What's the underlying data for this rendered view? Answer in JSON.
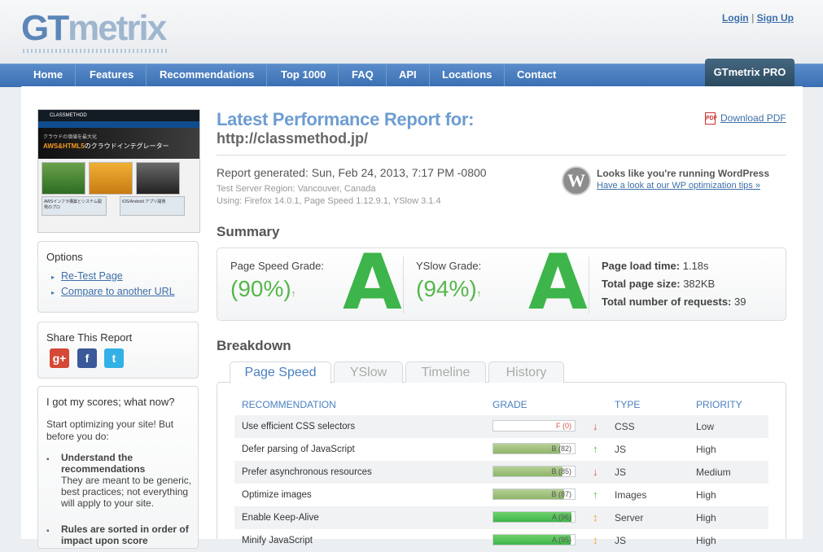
{
  "header": {
    "logo_gt": "GT",
    "logo_rest": "metrix",
    "login": "Login",
    "separator": "|",
    "signup": "Sign Up",
    "nav": [
      "Home",
      "Features",
      "Recommendations",
      "Top 1000",
      "FAQ",
      "API",
      "Locations",
      "Contact"
    ],
    "pro": "GTmetrix PRO"
  },
  "thumbnail": {
    "brand": "CLASSMETHOD",
    "hero_line1": "クラウドの価値を最大化",
    "hero_line2_a": "AWS&HTML5",
    "hero_line2_b": "のクラウドインテグレーター",
    "card1": "AWSインフラ構築とシステム開発のプロ",
    "card2": "iOS/Android アプリ開発"
  },
  "options": {
    "title": "Options",
    "links": [
      "Re-Test Page",
      "Compare to another URL"
    ]
  },
  "share": {
    "title": "Share This Report",
    "icons": [
      "google-plus-icon",
      "facebook-icon",
      "twitter-icon"
    ],
    "glyphs": [
      "g+",
      "f",
      "t"
    ],
    "colors": [
      "#d64937",
      "#3b5998",
      "#33b1e6"
    ]
  },
  "scores_help": {
    "title": "I got my scores; what now?",
    "intro": "Start optimizing your site! But before you do:",
    "item1_title": "Understand the recommendations",
    "item1_body": "They are meant to be generic, best practices; not everything will apply to your site.",
    "item2_title": "Rules are sorted in order of impact upon score"
  },
  "report": {
    "title": "Latest Performance Report for:",
    "url": "http://classmethod.jp/",
    "download": "Download PDF",
    "generated": "Report generated: Sun, Feb 24, 2013, 7:17 PM -0800",
    "region": "Test Server Region: Vancouver, Canada",
    "using": "Using: Firefox 14.0.1, Page Speed 1.12.9.1, YSlow 3.1.4",
    "wp_title": "Looks like you're running WordPress",
    "wp_link": "Have a look at our WP optimization tips »"
  },
  "summary": {
    "heading": "Summary",
    "pagespeed_label": "Page Speed Grade:",
    "pagespeed_pct": "(90%)",
    "pagespeed_grade": "A",
    "yslow_label": "YSlow Grade:",
    "yslow_pct": "(94%)",
    "yslow_grade": "A",
    "arrow": "↑",
    "load_time_label": "Page load time:",
    "load_time": "1.18s",
    "page_size_label": "Total page size:",
    "page_size": "382KB",
    "requests_label": "Total number of requests:",
    "requests": "39"
  },
  "breakdown": {
    "heading": "Breakdown",
    "tabs": [
      "Page Speed",
      "YSlow",
      "Timeline",
      "History"
    ],
    "columns": [
      "RECOMMENDATION",
      "GRADE",
      "TYPE",
      "PRIORITY"
    ],
    "rows": [
      {
        "rec": "Use efficient CSS selectors",
        "grade": "F (0)",
        "score": 0,
        "trend": "↓",
        "type": "CSS",
        "priority": "Low"
      },
      {
        "rec": "Defer parsing of JavaScript",
        "grade": "B (82)",
        "score": 82,
        "trend": "↑",
        "type": "JS",
        "priority": "High"
      },
      {
        "rec": "Prefer asynchronous resources",
        "grade": "B (85)",
        "score": 85,
        "trend": "↓",
        "type": "JS",
        "priority": "Medium"
      },
      {
        "rec": "Optimize images",
        "grade": "B (87)",
        "score": 87,
        "trend": "↑",
        "type": "Images",
        "priority": "High"
      },
      {
        "rec": "Enable Keep-Alive",
        "grade": "A (96)",
        "score": 96,
        "trend": "↕",
        "type": "Server",
        "priority": "High"
      },
      {
        "rec": "Minify JavaScript",
        "grade": "A (95)",
        "score": 95,
        "trend": "↕",
        "type": "JS",
        "priority": "High"
      }
    ],
    "colors": {
      "green": "#55b74b",
      "red": "#d9534f",
      "orange": "#f0a030",
      "gradeB": "#8fb46a",
      "gradeA": "#3db54a"
    }
  }
}
